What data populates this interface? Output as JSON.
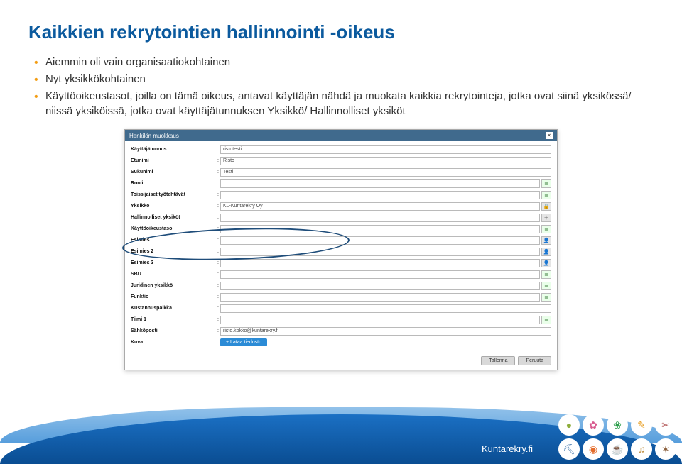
{
  "slide": {
    "title": "Kaikkien rekrytointien hallinnointi -oikeus",
    "bullets": [
      "Aiemmin oli vain organisaatiokohtainen",
      "Nyt yksikkökohtainen",
      "Käyttöoikeustasot, joilla on tämä oikeus, antavat käyttäjän nähdä ja muokata kaikkia rekrytointeja, jotka ovat siinä yksikössä/ niissä yksiköissä, jotka ovat käyttäjätunnuksen Yksikkö/ Hallinnolliset yksiköt"
    ]
  },
  "modal": {
    "title": "Henkilön muokkaus",
    "close_glyph": "×",
    "rows": [
      {
        "label": "Käyttäjätunnus",
        "value": "ristotesti",
        "icons": []
      },
      {
        "label": "Etunimi",
        "value": "Risto",
        "icons": []
      },
      {
        "label": "Sukunimi",
        "value": "Testi",
        "icons": []
      },
      {
        "label": "Rooli",
        "value": "",
        "icons": [
          "list"
        ]
      },
      {
        "label": "Toissijaiset työtehtävät",
        "value": "",
        "icons": [
          "list"
        ]
      },
      {
        "label": "Yksikkö",
        "value": "KL-Kuntarekry Oy",
        "icons": [
          "gray-lock"
        ]
      },
      {
        "label": "Hallinnolliset yksiköt",
        "value": "",
        "icons": [
          "gray-plus"
        ]
      },
      {
        "label": "Käyttöoikeustaso",
        "value": "",
        "icons": [
          "list"
        ]
      },
      {
        "label": "Esimies",
        "value": "",
        "icons": [
          "gray-user"
        ]
      },
      {
        "label": "Esimies 2",
        "value": "",
        "icons": [
          "gray-user"
        ]
      },
      {
        "label": "Esimies 3",
        "value": "",
        "icons": [
          "gray-user"
        ]
      },
      {
        "label": "SBU",
        "value": "",
        "icons": [
          "list"
        ]
      },
      {
        "label": "Juridinen yksikkö",
        "value": "",
        "icons": [
          "list"
        ]
      },
      {
        "label": "Funktio",
        "value": "",
        "icons": [
          "list"
        ]
      },
      {
        "label": "Kustannuspaikka",
        "value": "",
        "icons": []
      },
      {
        "label": "Tiimi 1",
        "value": "",
        "icons": [
          "list"
        ]
      },
      {
        "label": "Sähköposti",
        "value": "risto.kokko@kuntarekry.fi",
        "icons": []
      }
    ],
    "kuva_label": "Kuva",
    "kuva_button": "+ Lataa tiedosto",
    "footer": {
      "save": "Tallenna",
      "cancel": "Peruuta"
    }
  },
  "footer": {
    "brand": "Kuntarekry.fi"
  },
  "icons": {
    "glyphs": {
      "list": "≣",
      "gray-lock": "🔒",
      "gray-plus": "＋",
      "gray-user": "👤"
    },
    "cluster": [
      "⬤",
      "✿",
      "❀",
      "✏",
      "✂",
      "⛏",
      "🎨",
      "☕",
      "♫",
      "✶"
    ]
  }
}
